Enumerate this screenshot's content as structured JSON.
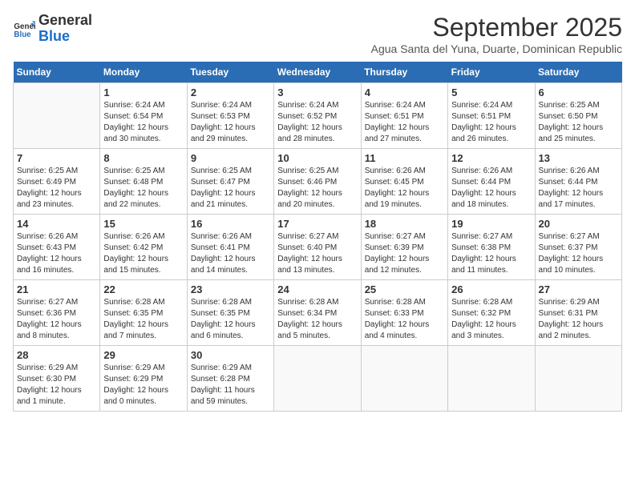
{
  "header": {
    "logo_line1": "General",
    "logo_line2": "Blue",
    "month_title": "September 2025",
    "subtitle": "Agua Santa del Yuna, Duarte, Dominican Republic"
  },
  "days_of_week": [
    "Sunday",
    "Monday",
    "Tuesday",
    "Wednesday",
    "Thursday",
    "Friday",
    "Saturday"
  ],
  "weeks": [
    [
      {
        "day": "",
        "text": ""
      },
      {
        "day": "1",
        "text": "Sunrise: 6:24 AM\nSunset: 6:54 PM\nDaylight: 12 hours\nand 30 minutes."
      },
      {
        "day": "2",
        "text": "Sunrise: 6:24 AM\nSunset: 6:53 PM\nDaylight: 12 hours\nand 29 minutes."
      },
      {
        "day": "3",
        "text": "Sunrise: 6:24 AM\nSunset: 6:52 PM\nDaylight: 12 hours\nand 28 minutes."
      },
      {
        "day": "4",
        "text": "Sunrise: 6:24 AM\nSunset: 6:51 PM\nDaylight: 12 hours\nand 27 minutes."
      },
      {
        "day": "5",
        "text": "Sunrise: 6:24 AM\nSunset: 6:51 PM\nDaylight: 12 hours\nand 26 minutes."
      },
      {
        "day": "6",
        "text": "Sunrise: 6:25 AM\nSunset: 6:50 PM\nDaylight: 12 hours\nand 25 minutes."
      }
    ],
    [
      {
        "day": "7",
        "text": "Sunrise: 6:25 AM\nSunset: 6:49 PM\nDaylight: 12 hours\nand 23 minutes."
      },
      {
        "day": "8",
        "text": "Sunrise: 6:25 AM\nSunset: 6:48 PM\nDaylight: 12 hours\nand 22 minutes."
      },
      {
        "day": "9",
        "text": "Sunrise: 6:25 AM\nSunset: 6:47 PM\nDaylight: 12 hours\nand 21 minutes."
      },
      {
        "day": "10",
        "text": "Sunrise: 6:25 AM\nSunset: 6:46 PM\nDaylight: 12 hours\nand 20 minutes."
      },
      {
        "day": "11",
        "text": "Sunrise: 6:26 AM\nSunset: 6:45 PM\nDaylight: 12 hours\nand 19 minutes."
      },
      {
        "day": "12",
        "text": "Sunrise: 6:26 AM\nSunset: 6:44 PM\nDaylight: 12 hours\nand 18 minutes."
      },
      {
        "day": "13",
        "text": "Sunrise: 6:26 AM\nSunset: 6:44 PM\nDaylight: 12 hours\nand 17 minutes."
      }
    ],
    [
      {
        "day": "14",
        "text": "Sunrise: 6:26 AM\nSunset: 6:43 PM\nDaylight: 12 hours\nand 16 minutes."
      },
      {
        "day": "15",
        "text": "Sunrise: 6:26 AM\nSunset: 6:42 PM\nDaylight: 12 hours\nand 15 minutes."
      },
      {
        "day": "16",
        "text": "Sunrise: 6:26 AM\nSunset: 6:41 PM\nDaylight: 12 hours\nand 14 minutes."
      },
      {
        "day": "17",
        "text": "Sunrise: 6:27 AM\nSunset: 6:40 PM\nDaylight: 12 hours\nand 13 minutes."
      },
      {
        "day": "18",
        "text": "Sunrise: 6:27 AM\nSunset: 6:39 PM\nDaylight: 12 hours\nand 12 minutes."
      },
      {
        "day": "19",
        "text": "Sunrise: 6:27 AM\nSunset: 6:38 PM\nDaylight: 12 hours\nand 11 minutes."
      },
      {
        "day": "20",
        "text": "Sunrise: 6:27 AM\nSunset: 6:37 PM\nDaylight: 12 hours\nand 10 minutes."
      }
    ],
    [
      {
        "day": "21",
        "text": "Sunrise: 6:27 AM\nSunset: 6:36 PM\nDaylight: 12 hours\nand 8 minutes."
      },
      {
        "day": "22",
        "text": "Sunrise: 6:28 AM\nSunset: 6:35 PM\nDaylight: 12 hours\nand 7 minutes."
      },
      {
        "day": "23",
        "text": "Sunrise: 6:28 AM\nSunset: 6:35 PM\nDaylight: 12 hours\nand 6 minutes."
      },
      {
        "day": "24",
        "text": "Sunrise: 6:28 AM\nSunset: 6:34 PM\nDaylight: 12 hours\nand 5 minutes."
      },
      {
        "day": "25",
        "text": "Sunrise: 6:28 AM\nSunset: 6:33 PM\nDaylight: 12 hours\nand 4 minutes."
      },
      {
        "day": "26",
        "text": "Sunrise: 6:28 AM\nSunset: 6:32 PM\nDaylight: 12 hours\nand 3 minutes."
      },
      {
        "day": "27",
        "text": "Sunrise: 6:29 AM\nSunset: 6:31 PM\nDaylight: 12 hours\nand 2 minutes."
      }
    ],
    [
      {
        "day": "28",
        "text": "Sunrise: 6:29 AM\nSunset: 6:30 PM\nDaylight: 12 hours\nand 1 minute."
      },
      {
        "day": "29",
        "text": "Sunrise: 6:29 AM\nSunset: 6:29 PM\nDaylight: 12 hours\nand 0 minutes."
      },
      {
        "day": "30",
        "text": "Sunrise: 6:29 AM\nSunset: 6:28 PM\nDaylight: 11 hours\nand 59 minutes."
      },
      {
        "day": "",
        "text": ""
      },
      {
        "day": "",
        "text": ""
      },
      {
        "day": "",
        "text": ""
      },
      {
        "day": "",
        "text": ""
      }
    ]
  ]
}
